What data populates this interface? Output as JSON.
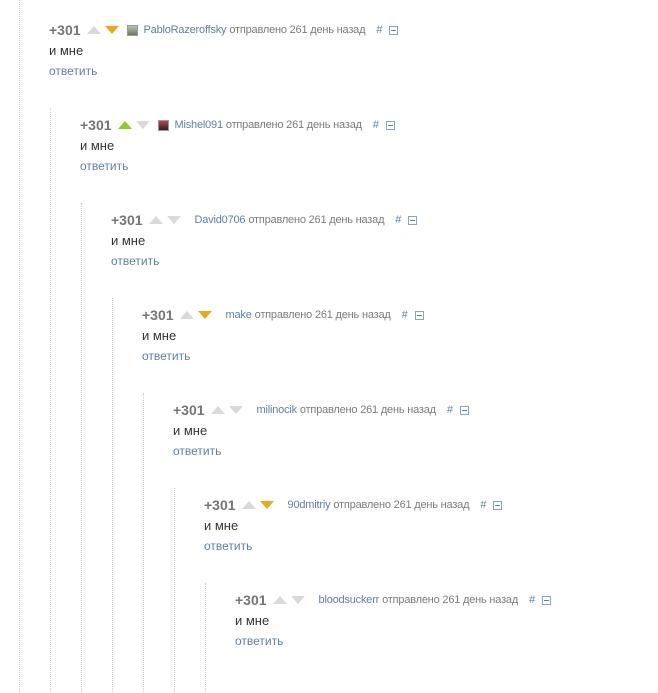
{
  "colors": {
    "link": "#5e7fa4",
    "upvote_active": "#8ecc2a",
    "downvote_active": "#eba91f",
    "arrow_inactive": "#d9d9d9"
  },
  "comments": [
    {
      "rating": "+301",
      "vote": "down",
      "avatar": "avatar-pablo",
      "author": "PabloRazeroffsky",
      "meta": "отправлено 261 день назад",
      "hash": "#",
      "text": "и мне",
      "reply": "ответить"
    },
    {
      "rating": "+301",
      "vote": "up",
      "avatar": "avatar-mishel",
      "author": "Mishel091",
      "meta": "отправлено 261 день назад",
      "hash": "#",
      "text": "и мне",
      "reply": "ответить"
    },
    {
      "rating": "+301",
      "vote": "none",
      "avatar": "",
      "author": "David0706",
      "meta": "отправлено 261 день назад",
      "hash": "#",
      "text": "и мне",
      "reply": "ответить"
    },
    {
      "rating": "+301",
      "vote": "down",
      "avatar": "",
      "author": "make",
      "meta": "отправлено 261 день назад",
      "hash": "#",
      "text": "и мне",
      "reply": "ответить"
    },
    {
      "rating": "+301",
      "vote": "none",
      "avatar": "",
      "author": "milinocik",
      "meta": "отправлено 261 день назад",
      "hash": "#",
      "text": "и мне",
      "reply": "ответить"
    },
    {
      "rating": "+301",
      "vote": "down",
      "avatar": "",
      "author": "90dmitriy",
      "meta": "отправлено 261 день назад",
      "hash": "#",
      "text": "и мне",
      "reply": "ответить"
    },
    {
      "rating": "+301",
      "vote": "none",
      "avatar": "",
      "author": "bloodsuckerr",
      "meta": "отправлено 261 день назад",
      "hash": "#",
      "text": "и мне",
      "reply": "ответить"
    }
  ]
}
